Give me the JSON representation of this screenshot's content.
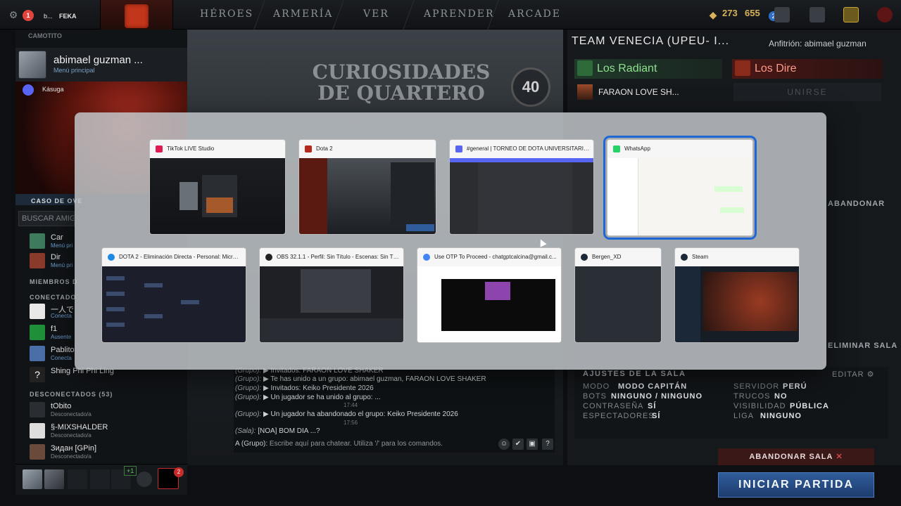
{
  "topbar": {
    "user_short": "b...",
    "guild_tag": "FEKA",
    "nav": [
      "HÉROES",
      "ARMERÍA",
      "VER",
      "APRENDER",
      "ARCADE"
    ],
    "shards": "273",
    "gold": "655",
    "chat_badge": "2",
    "discord_badge": "1"
  },
  "friends": {
    "header_sub": "CAMOTITO",
    "profile_name": "abimael guzman ...",
    "profile_sub": "Menú principal",
    "discord_label": "Kásuga",
    "case_label": "CASO DE OVE",
    "search_placeholder": "BUSCAR AMIGO",
    "items": [
      {
        "name": "Car",
        "status": "Menú pri"
      },
      {
        "name": "Dir",
        "status": "Menú pri"
      }
    ],
    "section_members": "MIEMBROS D",
    "section_connected": "CONECTADO",
    "connected": [
      {
        "name": "一人で",
        "status": "Conecta"
      },
      {
        "name": "f1",
        "status": "Ausente"
      },
      {
        "name": "Pablito",
        "status": "Conecta"
      },
      {
        "name": "Shing Phi Phi Ling",
        "status": ""
      }
    ],
    "section_disconnected": "DESCONECTADOS (53)",
    "disconnected": [
      {
        "name": "tObito",
        "status": "Desconectado/a"
      },
      {
        "name": "§-MIXSHALDER",
        "status": "Desconectado/a"
      },
      {
        "name": "Зидан [GPin]",
        "status": "Desconectado/a"
      }
    ],
    "party_plus": "+1",
    "party_badge": "2"
  },
  "center": {
    "title_line1": "CURIOSIDADES",
    "title_line2": "DE QUARTERO",
    "episode": "40"
  },
  "chat": {
    "lines": [
      {
        "tag": "(Grupo):",
        "text": "▶ Invitados: FARAON LOVE SHAKER"
      },
      {
        "tag": "(Grupo):",
        "text": "▶ Te has unido a un grupo: abimael guzman, FARAON LOVE SHAKER"
      },
      {
        "tag": "(Grupo):",
        "text": "▶ Invitados: Keiko Presidente 2026"
      },
      {
        "tag": "(Grupo):",
        "text": "▶ Un jugador se ha unido al grupo: ..."
      },
      {
        "tag": "(Grupo):",
        "text": "▶ Un jugador ha abandonado el grupo: Keiko Presidente 2026"
      },
      {
        "tag": "(Sala):",
        "text": "[NOA] BOM DIA ...?"
      }
    ],
    "time1": "17:44",
    "time2": "17:56",
    "input_prefix": "A (Grupo):",
    "input_placeholder": "Escribe aquí para chatear. Utiliza '/' para los comandos."
  },
  "lobby": {
    "team_title": "TEAM VENECIA  (UPEU- I...",
    "host": "Anfitrión: abimael guzman",
    "radiant": "Los Radiant",
    "dire": "Los Dire",
    "radiant_player": "FARAON LOVE SH...",
    "join": "UNIRSE",
    "abandon_short": "ABANDONAR",
    "delete_room": "ELIMINAR SALA",
    "settings_title": "AJUSTES DE LA SALA",
    "settings_edit": "EDITAR",
    "settings": [
      {
        "k": "MODO",
        "v": "MODO CAPITÁN"
      },
      {
        "k": "BOTS",
        "v": "NINGUNO / NINGUNO"
      },
      {
        "k": "CONTRASEÑA",
        "v": "SÍ"
      },
      {
        "k": "ESPECTADORES",
        "v": "SÍ"
      },
      {
        "k": "SERVIDOR",
        "v": "PERÚ"
      },
      {
        "k": "TRUCOS",
        "v": "NO"
      },
      {
        "k": "VISIBILIDAD",
        "v": "PÚBLICA"
      },
      {
        "k": "LIGA",
        "v": "NINGUNO"
      }
    ],
    "leave_button": "ABANDONAR SALA",
    "start_button": "INICIAR PARTIDA"
  },
  "switcher": {
    "windows": [
      {
        "title": "TikTok LIVE Studio",
        "icon_color": "#e01a4f"
      },
      {
        "title": "Dota 2",
        "icon_color": "#b5281b"
      },
      {
        "title": "#general | TORNEO DE DOTA UNIVERSITARIA - ...",
        "icon_color": "#5865f2"
      },
      {
        "title": "WhatsApp",
        "icon_color": "#25d366"
      },
      {
        "title": "DOTA 2 - Eliminación Directa - Personal: Micros...",
        "icon_color": "#1e88e5"
      },
      {
        "title": "OBS 32.1.1 - Perfil: Sin Título - Escenas: Sin Título",
        "icon_color": "#222222"
      },
      {
        "title": "Use OTP To Proceed - chatgptcalcina@gmail.c...",
        "icon_color": "#4285f4"
      },
      {
        "title": "Bergen_XD",
        "icon_color": "#1b2838"
      },
      {
        "title": "Steam",
        "icon_color": "#1b2838"
      }
    ],
    "selected_index": 3
  }
}
